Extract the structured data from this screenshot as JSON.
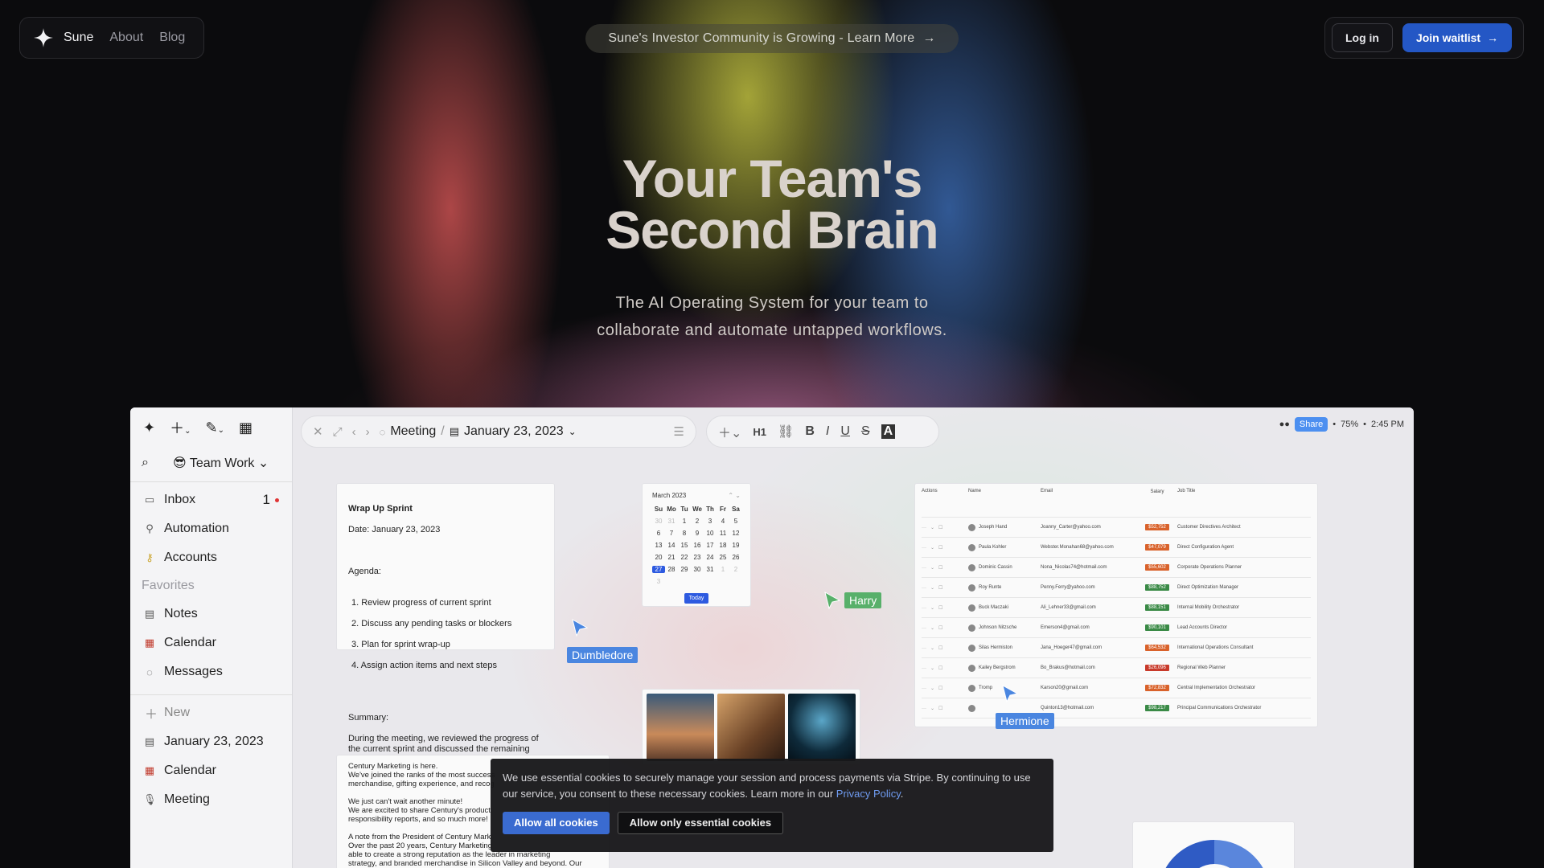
{
  "nav": {
    "brand": "Sune",
    "links": [
      "About",
      "Blog"
    ],
    "announcement": "Sune's Investor Community is Growing - Learn More",
    "login": "Log in",
    "join": "Join waitlist"
  },
  "hero": {
    "title_line1": "Your Team's",
    "title_line2": "Second Brain",
    "subtitle_line1": "The AI Operating System for your team to",
    "subtitle_line2": "collaborate and automate untapped workflows."
  },
  "app": {
    "workspace": "Team Work",
    "sidebar": {
      "items": [
        {
          "label": "Inbox",
          "icon": "inbox-icon",
          "badge": "1"
        },
        {
          "label": "Automation",
          "icon": "automation-icon"
        },
        {
          "label": "Accounts",
          "icon": "key-icon"
        }
      ],
      "favorites_label": "Favorites",
      "favorites": [
        {
          "label": "Notes",
          "icon": "notebook-icon"
        },
        {
          "label": "Calendar",
          "icon": "calendar-icon"
        },
        {
          "label": "Messages",
          "icon": "chat-icon"
        }
      ],
      "new_label": "New",
      "recent": [
        {
          "label": "January 23, 2023",
          "icon": "notebook-icon"
        },
        {
          "label": "Calendar",
          "icon": "calendar-icon"
        },
        {
          "label": "Meeting",
          "icon": "mic-icon"
        }
      ]
    },
    "breadcrumb": {
      "first": "Meeting",
      "second": "January 23, 2023"
    },
    "format_toolbar": [
      "H1",
      "B",
      "I",
      "U",
      "S",
      "A"
    ],
    "status": {
      "share": "Share",
      "zoom": "75%",
      "time": "2:45 PM"
    },
    "note1": {
      "title": "Wrap Up Sprint",
      "date": "Date: January 23, 2023",
      "agenda_label": "Agenda:",
      "agenda": [
        "1. Review progress of current sprint",
        "2. Discuss any pending tasks or blockers",
        "3. Plan for sprint wrap-up",
        "4. Assign action items and next steps"
      ],
      "summary_label": "Summary:",
      "summary": "During the meeting, we reviewed the progress of the current sprint and discussed the remaining tasks and any blockers that need to be addressed."
    },
    "calendar": {
      "month": "March 2023",
      "weekdays": [
        "Su",
        "Mo",
        "Tu",
        "We",
        "Th",
        "Fr",
        "Sa"
      ],
      "days": [
        "30",
        "31",
        "1",
        "2",
        "3",
        "4",
        "5",
        "6",
        "7",
        "8",
        "9",
        "10",
        "11",
        "12",
        "13",
        "14",
        "15",
        "16",
        "17",
        "18",
        "19",
        "20",
        "21",
        "22",
        "23",
        "24",
        "25",
        "26",
        "27",
        "28",
        "29",
        "30",
        "31",
        "1",
        "2",
        "3"
      ],
      "today": "Today"
    },
    "table": {
      "headers": [
        "Actions",
        "Name",
        "Email",
        "Salary",
        "Job Title"
      ],
      "rows": [
        {
          "name": "Joseph Hand",
          "email": "Joanny_Carter@yahoo.com",
          "salary": "$52,752",
          "salary_color": "#d9622b",
          "job": "Customer Directives Architect"
        },
        {
          "name": "Paula Kohler",
          "email": "Webster.Monahan68@yahoo.com",
          "salary": "$47,079",
          "salary_color": "#d9622b",
          "job": "Direct Configuration Agent"
        },
        {
          "name": "Dominic Cassin",
          "email": "Nona_Nicolas74@hotmail.com",
          "salary": "$55,602",
          "salary_color": "#d9622b",
          "job": "Corporate Operations Planner"
        },
        {
          "name": "Roy Runte",
          "email": "Penny.Ferry@yahoo.com",
          "salary": "$88,752",
          "salary_color": "#3a8a46",
          "job": "Direct Optimization Manager"
        },
        {
          "name": "Buck Maczaki",
          "email": "Ali_Lehner33@gmail.com",
          "salary": "$88,151",
          "salary_color": "#3a8a46",
          "job": "Internal Mobility Orchestrator"
        },
        {
          "name": "Johnson Nitzsche",
          "email": "Emerson4@gmail.com",
          "salary": "$90,101",
          "salary_color": "#3a8a46",
          "job": "Lead Accounts Director"
        },
        {
          "name": "Silas Hermiston",
          "email": "Jana_Hoeger47@gmail.com",
          "salary": "$64,532",
          "salary_color": "#d9622b",
          "job": "International Operations Consultant"
        },
        {
          "name": "Kailey Bergstrom",
          "email": "Bo_Brakus@hotmail.com",
          "salary": "$26,096",
          "salary_color": "#c83a2a",
          "job": "Regional Web Planner"
        },
        {
          "name": "Tromp",
          "email": "Karson20@gmail.com",
          "salary": "$72,832",
          "salary_color": "#d9622b",
          "job": "Central Implementation Orchestrator"
        },
        {
          "name": "",
          "email": "Quinton13@hotmail.com",
          "salary": "$98,217",
          "salary_color": "#3a8a46",
          "job": "Principal Communications Orchestrator"
        }
      ]
    },
    "cursors": [
      {
        "name": "Dumbledore",
        "color": "#4a86e0"
      },
      {
        "name": "Harry",
        "color": "#58b06a"
      },
      {
        "name": "Hermione",
        "color": "#4a86e0"
      }
    ],
    "note2": {
      "text": "Century Marketing is here.\nWe've joined the ranks of the most success\nmerchandise, gifting experience, and recog\n\nWe just can't wait another minute!\nWe are excited to share Century's product\nresponsibility reports, and so much more!\n\nA note from the President of Century Mark\nOver the past 20 years, Century Marketing\nable to create a strong reputation as the leader in marketing\nstrategy, and branded merchandise in Silicon Valley and beyond. Our\nresponsive and creative approach has earned the trust and loyalty of"
    }
  },
  "cookie": {
    "text": "We use essential cookies to securely manage your session and process payments via Stripe. By continuing to use our service, you consent to these necessary cookies. Learn more in our ",
    "link": "Privacy Policy",
    "end": ".",
    "allow_all": "Allow all cookies",
    "allow_essential": "Allow only essential cookies"
  }
}
